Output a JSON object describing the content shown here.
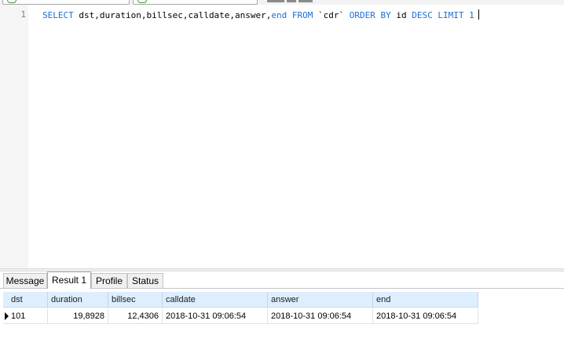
{
  "editor": {
    "line_number": "1",
    "sql": {
      "select": "SELECT",
      "columns": "dst,duration,billsec,calldate,answer,",
      "end_kw": "end",
      "from": "FROM",
      "table": "`cdr`",
      "order_by": "ORDER BY",
      "order_col": "id",
      "desc": "DESC",
      "limit": "LIMIT",
      "limit_val": "1"
    }
  },
  "tabs": [
    {
      "label": "Message",
      "active": false
    },
    {
      "label": "Result 1",
      "active": true
    },
    {
      "label": "Profile",
      "active": false
    },
    {
      "label": "Status",
      "active": false
    }
  ],
  "grid": {
    "columns": [
      "dst",
      "duration",
      "billsec",
      "calldate",
      "answer",
      "end"
    ],
    "rows": [
      [
        "101",
        "19,8928",
        "12,4306",
        "2018-10-31 09:06:54",
        "2018-10-31 09:06:54",
        "2018-10-31 09:06:54"
      ]
    ]
  },
  "colors": {
    "keyword": "#1f6fd0",
    "header_bg": "#ddeeff"
  }
}
